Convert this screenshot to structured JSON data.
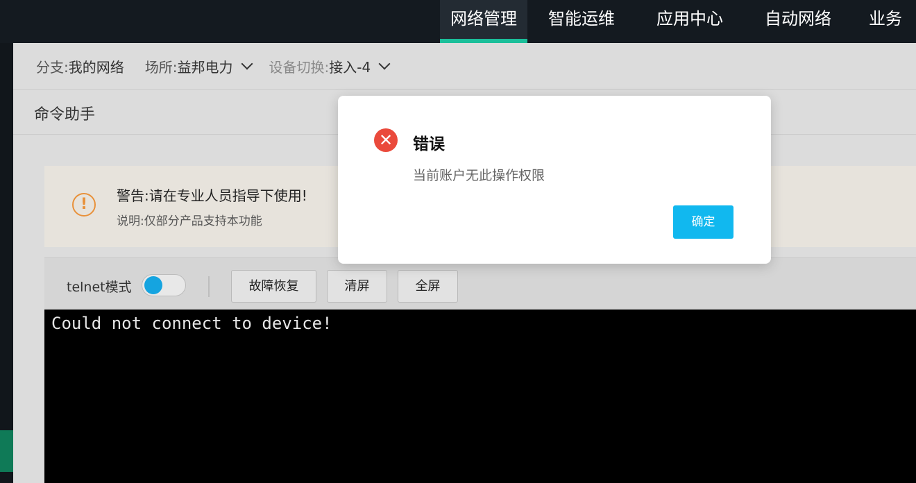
{
  "nav": {
    "items": [
      {
        "label": "网络管理",
        "active": true
      },
      {
        "label": "智能运维",
        "active": false
      },
      {
        "label": "应用中心",
        "active": false
      },
      {
        "label": "自动网络",
        "active": false
      },
      {
        "label": "业务",
        "active": false
      }
    ]
  },
  "breadcrumb": {
    "branch_label": "分支:",
    "branch_value": "我的网络",
    "site_label": "场所:",
    "site_value": "益邦电力",
    "device_label": "设备切换:",
    "device_value": "接入-4"
  },
  "page": {
    "title": "命令助手"
  },
  "warning": {
    "title": "警告:请在专业人员指导下使用!",
    "description": "说明:仅部分产品支持本功能",
    "icon": "exclamation-circle-icon"
  },
  "toolbar": {
    "telnet_label": "telnet模式",
    "telnet_enabled": false,
    "fault_recovery_label": "故障恢复",
    "clear_label": "清屏",
    "fullscreen_label": "全屏"
  },
  "terminal": {
    "output": "Could not connect to device!"
  },
  "dialog": {
    "title": "错误",
    "message": "当前账户无此操作权限",
    "ok_label": "确定",
    "icon": "error-circle-icon",
    "colors": {
      "error": "#ea4a3c",
      "primary": "#11b8ef"
    }
  },
  "colors": {
    "nav_accent": "#1bbf9a",
    "warning": "#e8913a"
  }
}
